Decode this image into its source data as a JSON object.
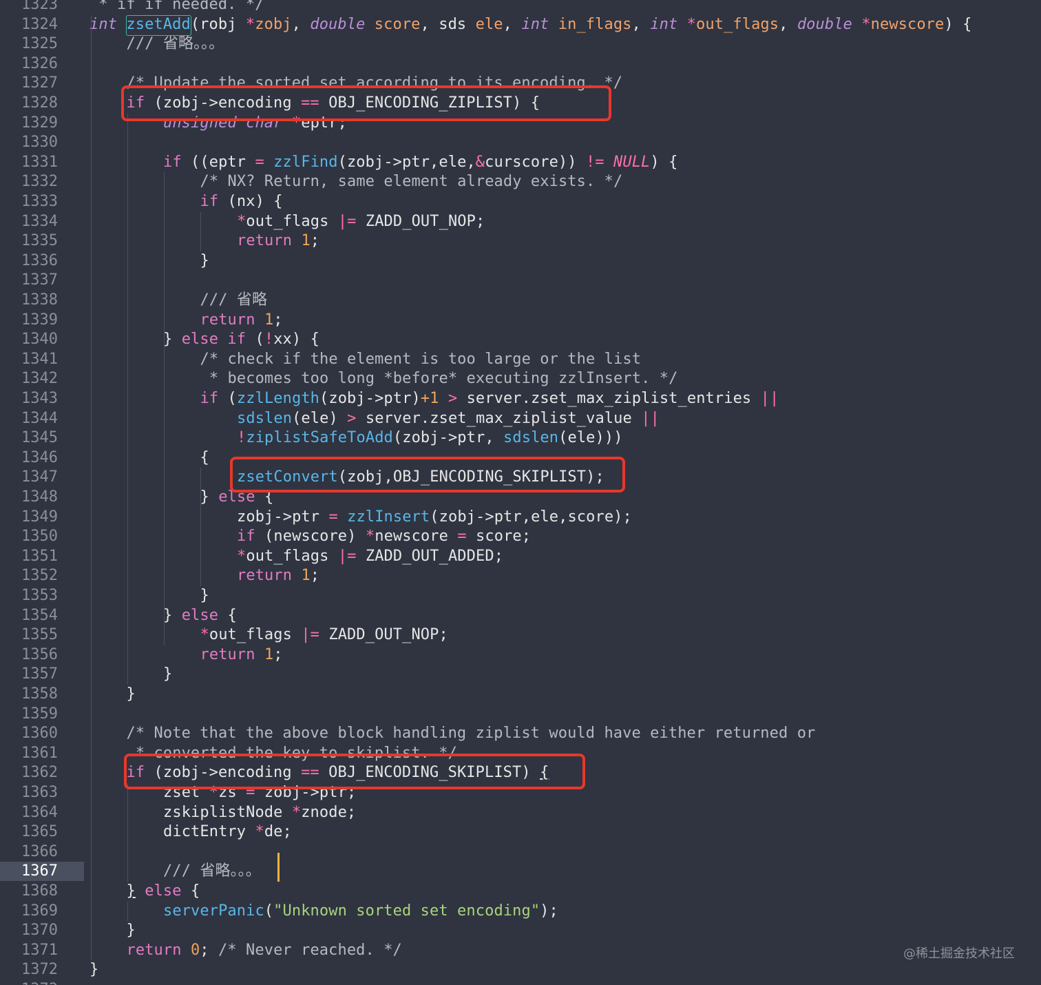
{
  "editor": {
    "current_line": "1367",
    "watermark": "@稀土掘金技术社区"
  },
  "lines": [
    {
      "num": "1323",
      "indent": 0,
      "segs": [
        {
          "t": " * if if needed. */",
          "c": "cm"
        }
      ]
    },
    {
      "num": "1324",
      "indent": 0,
      "segs": [
        {
          "t": "int",
          "c": "ty"
        },
        {
          "t": " "
        },
        {
          "t": "zsetAdd",
          "c": "fn"
        },
        {
          "t": "(robj "
        },
        {
          "t": "*",
          "c": "op"
        },
        {
          "t": "zobj",
          "c": "par"
        },
        {
          "t": ", "
        },
        {
          "t": "double",
          "c": "ty"
        },
        {
          "t": " "
        },
        {
          "t": "score",
          "c": "par"
        },
        {
          "t": ", sds "
        },
        {
          "t": "ele",
          "c": "par"
        },
        {
          "t": ", "
        },
        {
          "t": "int",
          "c": "ty"
        },
        {
          "t": " "
        },
        {
          "t": "in_flags",
          "c": "par"
        },
        {
          "t": ", "
        },
        {
          "t": "int",
          "c": "ty"
        },
        {
          "t": " "
        },
        {
          "t": "*",
          "c": "op"
        },
        {
          "t": "out_flags",
          "c": "par"
        },
        {
          "t": ", "
        },
        {
          "t": "double",
          "c": "ty"
        },
        {
          "t": " "
        },
        {
          "t": "*",
          "c": "op"
        },
        {
          "t": "newscore",
          "c": "par"
        },
        {
          "t": ") {"
        }
      ]
    },
    {
      "num": "1325",
      "indent": 1,
      "segs": [
        {
          "t": "/// 省略。。。",
          "c": "cm"
        }
      ]
    },
    {
      "num": "1326",
      "indent": 0,
      "segs": []
    },
    {
      "num": "1327",
      "indent": 1,
      "segs": [
        {
          "t": "/* Update the sorted set according to its encoding. */",
          "c": "cm"
        }
      ]
    },
    {
      "num": "1328",
      "indent": 1,
      "segs": [
        {
          "t": "if",
          "c": "kw"
        },
        {
          "t": " (zobj->encoding "
        },
        {
          "t": "==",
          "c": "op"
        },
        {
          "t": " OBJ_ENCODING_ZIPLIST) {"
        }
      ]
    },
    {
      "num": "1329",
      "indent": 2,
      "segs": [
        {
          "t": "unsigned char",
          "c": "ty"
        },
        {
          "t": " "
        },
        {
          "t": "*",
          "c": "op"
        },
        {
          "t": "eptr;"
        }
      ]
    },
    {
      "num": "1330",
      "indent": 0,
      "segs": []
    },
    {
      "num": "1331",
      "indent": 2,
      "segs": [
        {
          "t": "if",
          "c": "kw"
        },
        {
          "t": " ((eptr "
        },
        {
          "t": "=",
          "c": "op"
        },
        {
          "t": " "
        },
        {
          "t": "zzlFind",
          "c": "fn"
        },
        {
          "t": "(zobj->ptr,ele,"
        },
        {
          "t": "&",
          "c": "op"
        },
        {
          "t": "curscore)) "
        },
        {
          "t": "!=",
          "c": "op"
        },
        {
          "t": " "
        },
        {
          "t": "NULL",
          "c": "nul"
        },
        {
          "t": ") {"
        }
      ]
    },
    {
      "num": "1332",
      "indent": 3,
      "segs": [
        {
          "t": "/* NX? Return, same element already exists. */",
          "c": "cm"
        }
      ]
    },
    {
      "num": "1333",
      "indent": 3,
      "segs": [
        {
          "t": "if",
          "c": "kw"
        },
        {
          "t": " (nx) {"
        }
      ]
    },
    {
      "num": "1334",
      "indent": 4,
      "segs": [
        {
          "t": "*",
          "c": "op"
        },
        {
          "t": "out_flags "
        },
        {
          "t": "|=",
          "c": "op"
        },
        {
          "t": " ZADD_OUT_NOP;"
        }
      ]
    },
    {
      "num": "1335",
      "indent": 4,
      "segs": [
        {
          "t": "return",
          "c": "kw"
        },
        {
          "t": " "
        },
        {
          "t": "1",
          "c": "num"
        },
        {
          "t": ";"
        }
      ]
    },
    {
      "num": "1336",
      "indent": 3,
      "segs": [
        {
          "t": "}"
        }
      ]
    },
    {
      "num": "1337",
      "indent": 0,
      "segs": []
    },
    {
      "num": "1338",
      "indent": 3,
      "segs": [
        {
          "t": "/// 省略",
          "c": "cm"
        }
      ]
    },
    {
      "num": "1339",
      "indent": 3,
      "segs": [
        {
          "t": "return",
          "c": "kw"
        },
        {
          "t": " "
        },
        {
          "t": "1",
          "c": "num"
        },
        {
          "t": ";"
        }
      ]
    },
    {
      "num": "1340",
      "indent": 2,
      "segs": [
        {
          "t": "} "
        },
        {
          "t": "else if",
          "c": "kw"
        },
        {
          "t": " ("
        },
        {
          "t": "!",
          "c": "op"
        },
        {
          "t": "xx) {"
        }
      ]
    },
    {
      "num": "1341",
      "indent": 3,
      "segs": [
        {
          "t": "/* check if the element is too large or the list",
          "c": "cm"
        }
      ]
    },
    {
      "num": "1342",
      "indent": 3,
      "segs": [
        {
          "t": " * becomes too long *before* executing zzlInsert. */",
          "c": "cm"
        }
      ]
    },
    {
      "num": "1343",
      "indent": 3,
      "segs": [
        {
          "t": "if",
          "c": "kw"
        },
        {
          "t": " ("
        },
        {
          "t": "zzlLength",
          "c": "fn"
        },
        {
          "t": "(zobj->ptr)"
        },
        {
          "t": "+1",
          "c": "num"
        },
        {
          "t": " "
        },
        {
          "t": ">",
          "c": "op"
        },
        {
          "t": " server.zset_max_ziplist_entries "
        },
        {
          "t": "||",
          "c": "op"
        }
      ]
    },
    {
      "num": "1344",
      "indent": 4,
      "segs": [
        {
          "t": "sdslen",
          "c": "fn"
        },
        {
          "t": "(ele) "
        },
        {
          "t": ">",
          "c": "op"
        },
        {
          "t": " server.zset_max_ziplist_value "
        },
        {
          "t": "||",
          "c": "op"
        }
      ]
    },
    {
      "num": "1345",
      "indent": 4,
      "segs": [
        {
          "t": "!",
          "c": "op"
        },
        {
          "t": "ziplistSafeToAdd",
          "c": "fn"
        },
        {
          "t": "(zobj->ptr, "
        },
        {
          "t": "sdslen",
          "c": "fn"
        },
        {
          "t": "(ele)))"
        }
      ]
    },
    {
      "num": "1346",
      "indent": 3,
      "segs": [
        {
          "t": "{"
        }
      ]
    },
    {
      "num": "1347",
      "indent": 4,
      "segs": [
        {
          "t": "zsetConvert",
          "c": "fn"
        },
        {
          "t": "(zobj,OBJ_ENCODING_SKIPLIST);"
        }
      ]
    },
    {
      "num": "1348",
      "indent": 3,
      "segs": [
        {
          "t": "} "
        },
        {
          "t": "else",
          "c": "kw"
        },
        {
          "t": " {"
        }
      ]
    },
    {
      "num": "1349",
      "indent": 4,
      "segs": [
        {
          "t": "zobj->ptr "
        },
        {
          "t": "=",
          "c": "op"
        },
        {
          "t": " "
        },
        {
          "t": "zzlInsert",
          "c": "fn"
        },
        {
          "t": "(zobj->ptr,ele,score);"
        }
      ]
    },
    {
      "num": "1350",
      "indent": 4,
      "segs": [
        {
          "t": "if",
          "c": "kw"
        },
        {
          "t": " (newscore) "
        },
        {
          "t": "*",
          "c": "op"
        },
        {
          "t": "newscore "
        },
        {
          "t": "=",
          "c": "op"
        },
        {
          "t": " score;"
        }
      ]
    },
    {
      "num": "1351",
      "indent": 4,
      "segs": [
        {
          "t": "*",
          "c": "op"
        },
        {
          "t": "out_flags "
        },
        {
          "t": "|=",
          "c": "op"
        },
        {
          "t": " ZADD_OUT_ADDED;"
        }
      ]
    },
    {
      "num": "1352",
      "indent": 4,
      "segs": [
        {
          "t": "return",
          "c": "kw"
        },
        {
          "t": " "
        },
        {
          "t": "1",
          "c": "num"
        },
        {
          "t": ";"
        }
      ]
    },
    {
      "num": "1353",
      "indent": 3,
      "segs": [
        {
          "t": "}"
        }
      ]
    },
    {
      "num": "1354",
      "indent": 2,
      "segs": [
        {
          "t": "} "
        },
        {
          "t": "else",
          "c": "kw"
        },
        {
          "t": " {"
        }
      ]
    },
    {
      "num": "1355",
      "indent": 3,
      "segs": [
        {
          "t": "*",
          "c": "op"
        },
        {
          "t": "out_flags "
        },
        {
          "t": "|=",
          "c": "op"
        },
        {
          "t": " ZADD_OUT_NOP;"
        }
      ]
    },
    {
      "num": "1356",
      "indent": 3,
      "segs": [
        {
          "t": "return",
          "c": "kw"
        },
        {
          "t": " "
        },
        {
          "t": "1",
          "c": "num"
        },
        {
          "t": ";"
        }
      ]
    },
    {
      "num": "1357",
      "indent": 2,
      "segs": [
        {
          "t": "}"
        }
      ]
    },
    {
      "num": "1358",
      "indent": 1,
      "segs": [
        {
          "t": "}"
        }
      ]
    },
    {
      "num": "1359",
      "indent": 0,
      "segs": []
    },
    {
      "num": "1360",
      "indent": 1,
      "segs": [
        {
          "t": "/* Note that the above block handling ziplist would have either returned or",
          "c": "cm"
        }
      ]
    },
    {
      "num": "1361",
      "indent": 1,
      "segs": [
        {
          "t": " * converted the key to skiplist. */",
          "c": "cm"
        }
      ]
    },
    {
      "num": "1362",
      "indent": 1,
      "segs": [
        {
          "t": "if",
          "c": "kw"
        },
        {
          "t": " (zobj->encoding "
        },
        {
          "t": "==",
          "c": "op"
        },
        {
          "t": " OBJ_ENCODING_SKIPLIST) "
        },
        {
          "t": "{",
          "u": true
        }
      ]
    },
    {
      "num": "1363",
      "indent": 2,
      "segs": [
        {
          "t": "zset "
        },
        {
          "t": "*",
          "c": "op"
        },
        {
          "t": "zs "
        },
        {
          "t": "=",
          "c": "op"
        },
        {
          "t": " zobj->ptr;"
        }
      ]
    },
    {
      "num": "1364",
      "indent": 2,
      "segs": [
        {
          "t": "zskiplistNode "
        },
        {
          "t": "*",
          "c": "op"
        },
        {
          "t": "znode;"
        }
      ]
    },
    {
      "num": "1365",
      "indent": 2,
      "segs": [
        {
          "t": "dictEntry "
        },
        {
          "t": "*",
          "c": "op"
        },
        {
          "t": "de;"
        }
      ]
    },
    {
      "num": "1366",
      "indent": 0,
      "segs": []
    },
    {
      "num": "1367",
      "indent": 2,
      "segs": [
        {
          "t": "/// 省略。。。",
          "c": "cm"
        }
      ]
    },
    {
      "num": "1368",
      "indent": 1,
      "segs": [
        {
          "t": "}",
          "u": true
        },
        {
          "t": " "
        },
        {
          "t": "else",
          "c": "kw"
        },
        {
          "t": " {"
        }
      ]
    },
    {
      "num": "1369",
      "indent": 2,
      "segs": [
        {
          "t": "serverPanic",
          "c": "fn"
        },
        {
          "t": "("
        },
        {
          "t": "\"Unknown sorted set encoding\"",
          "c": "str"
        },
        {
          "t": ");"
        }
      ]
    },
    {
      "num": "1370",
      "indent": 1,
      "segs": [
        {
          "t": "}"
        }
      ]
    },
    {
      "num": "1371",
      "indent": 1,
      "segs": [
        {
          "t": "return",
          "c": "kw"
        },
        {
          "t": " "
        },
        {
          "t": "0",
          "c": "num"
        },
        {
          "t": "; "
        },
        {
          "t": "/* Never reached. */",
          "c": "cm"
        }
      ]
    },
    {
      "num": "1372",
      "indent": 0,
      "segs": [
        {
          "t": "}"
        }
      ]
    },
    {
      "num": "1373",
      "indent": 0,
      "segs": []
    }
  ]
}
